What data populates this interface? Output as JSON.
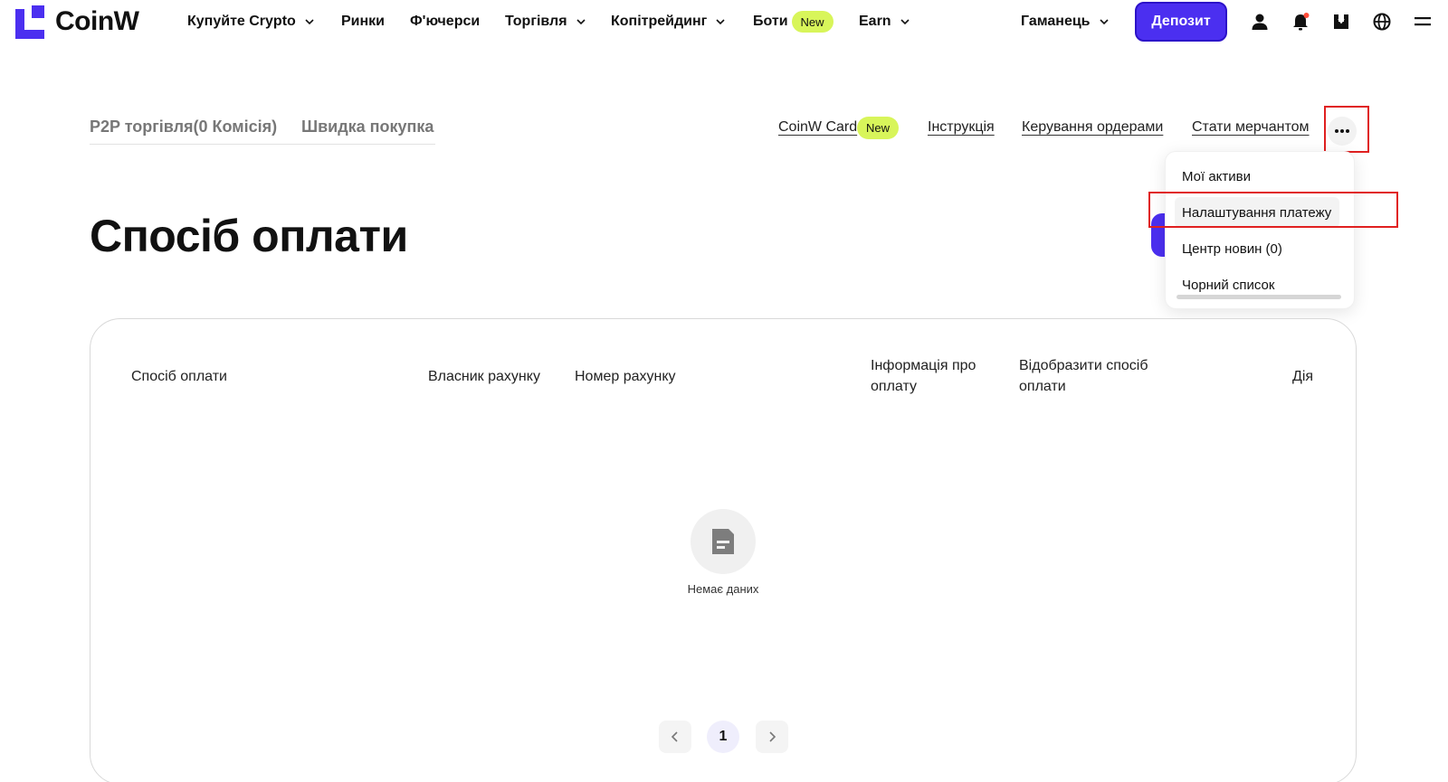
{
  "header": {
    "logo_text": "CoinW",
    "nav": {
      "buy_crypto": "Купуйте Crypto",
      "markets": "Ринки",
      "futures": "Ф'ючерси",
      "trading": "Торгівля",
      "copytrading": "Копітрейдинг",
      "bots": "Боти",
      "bots_badge": "New",
      "earn": "Earn"
    },
    "wallet": "Гаманець",
    "deposit": "Депозит"
  },
  "subnav": {
    "tabs": [
      "P2P торгівля(0 Комісія)",
      "Швидка покупка"
    ],
    "links": {
      "card": "CoinW Card",
      "card_badge": "New",
      "instruction": "Інструкція",
      "orders": "Керування ордерами",
      "merchant": "Стати мерчантом"
    }
  },
  "dropdown": {
    "items": [
      "Мої активи",
      "Налаштування платежу",
      "Центр новин (0)",
      "Чорний список"
    ],
    "active_index": 1
  },
  "page": {
    "title": "Спосіб оплати"
  },
  "table": {
    "columns": {
      "method": "Спосіб оплати",
      "owner": "Власник рахунку",
      "number": "Номер рахунку",
      "info": "Інформація про оплату",
      "display": "Відобразити спосіб оплати",
      "action": "Дія"
    },
    "empty_text": "Немає даних"
  },
  "pagination": {
    "current_page": "1"
  },
  "colors": {
    "accent": "#4b2ff0",
    "badge": "#d8f55a",
    "highlight": "#e02020"
  }
}
